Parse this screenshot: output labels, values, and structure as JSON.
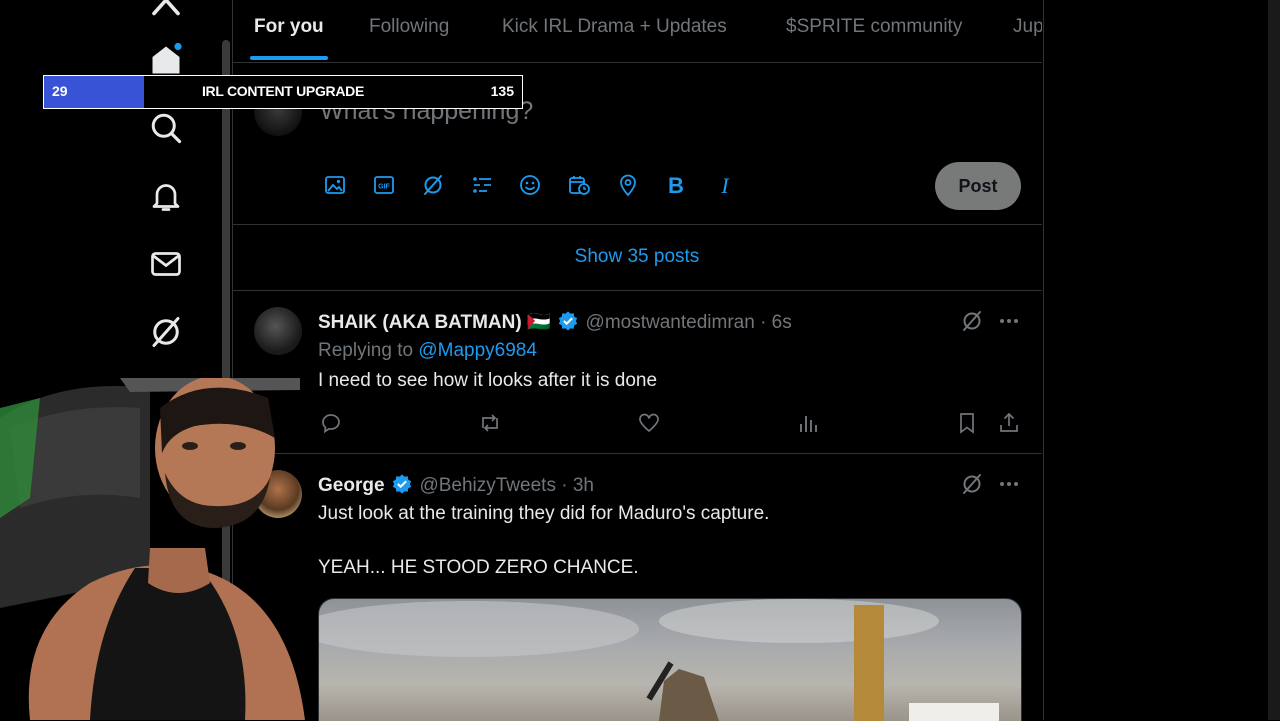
{
  "nav": {
    "icons": [
      "home-icon",
      "search-icon",
      "bell-icon",
      "mail-icon",
      "grok-icon"
    ],
    "home_has_dot": true
  },
  "tabs": [
    {
      "label": "For you",
      "active": true
    },
    {
      "label": "Following",
      "active": false
    },
    {
      "label": "Kick IRL Drama + Updates",
      "active": false
    },
    {
      "label": "$SPRITE community",
      "active": false
    },
    {
      "label": "Jup",
      "active": false
    }
  ],
  "composer": {
    "placeholder": "What's happening?",
    "post_label": "Post",
    "toolbar_icons": [
      "image-icon",
      "gif-icon",
      "grok-icon",
      "poll-icon",
      "emoji-icon",
      "schedule-icon",
      "location-icon",
      "bold-icon",
      "italic-icon"
    ]
  },
  "show_posts": "Show 35 posts",
  "tweets": [
    {
      "name": "SHAIK (AKA BATMAN) 🇵🇸",
      "handle": "@mostwantedimran · 6s",
      "replying_prefix": "Replying to ",
      "replying_to": "@Mappy6984",
      "text": "I need to see how it looks after it is done"
    },
    {
      "name": "George",
      "handle": "@BehizyTweets · 3h",
      "text_line1": "Just look at the training they did for Maduro's capture.",
      "text_line2": "YEAH... HE STOOD ZERO CHANCE."
    }
  ],
  "overlay": {
    "left_value": "29",
    "label": "IRL CONTENT UPGRADE",
    "right_value": "135",
    "progress": 0.21
  },
  "colors": {
    "accent": "#1d9bf0",
    "background": "#000000",
    "border": "#2f3336",
    "muted": "#71767b",
    "goal_fill": "#3953d6"
  }
}
